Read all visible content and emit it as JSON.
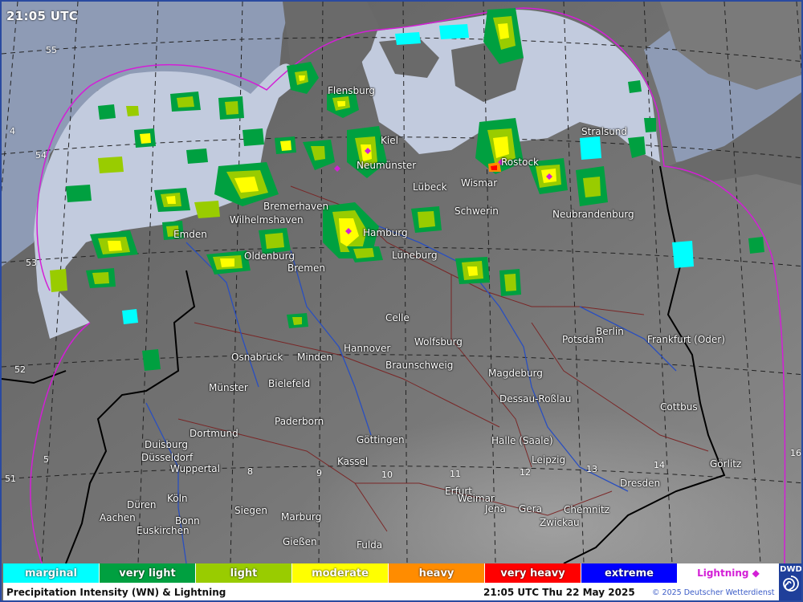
{
  "time_label": "21:05 UTC",
  "cities": [
    {
      "name": "Flensburg",
      "key": "flensburg"
    },
    {
      "name": "Kiel",
      "key": "kiel"
    },
    {
      "name": "Neumünster",
      "key": "neumuenster"
    },
    {
      "name": "Stralsund",
      "key": "stralsund"
    },
    {
      "name": "Rostock",
      "key": "rostock"
    },
    {
      "name": "Lübeck",
      "key": "luebeck"
    },
    {
      "name": "Wismar",
      "key": "wismar"
    },
    {
      "name": "Bremerhaven",
      "key": "bremerhaven"
    },
    {
      "name": "Wilhelmshaven",
      "key": "wilhelmshaven"
    },
    {
      "name": "Schwerin",
      "key": "schwerin"
    },
    {
      "name": "Neubrandenburg",
      "key": "neubrandenburg"
    },
    {
      "name": "Emden",
      "key": "emden"
    },
    {
      "name": "Hamburg",
      "key": "hamburg"
    },
    {
      "name": "Oldenburg",
      "key": "oldenburg"
    },
    {
      "name": "Bremen",
      "key": "bremen"
    },
    {
      "name": "Lüneburg",
      "key": "lueneburg"
    },
    {
      "name": "Celle",
      "key": "celle"
    },
    {
      "name": "Berlin",
      "key": "berlin"
    },
    {
      "name": "Wolfsburg",
      "key": "wolfsburg"
    },
    {
      "name": "Osnabrück",
      "key": "osnabrueck"
    },
    {
      "name": "Minden",
      "key": "minden"
    },
    {
      "name": "Hannover",
      "key": "hannover"
    },
    {
      "name": "Potsdam",
      "key": "potsdam"
    },
    {
      "name": "Frankfurt (Oder)",
      "key": "frankfurt_oder"
    },
    {
      "name": "Braunschweig",
      "key": "braunschweig"
    },
    {
      "name": "Magdeburg",
      "key": "magdeburg"
    },
    {
      "name": "Münster",
      "key": "muenster"
    },
    {
      "name": "Bielefeld",
      "key": "bielefeld"
    },
    {
      "name": "Dessau-Roßlau",
      "key": "dessau"
    },
    {
      "name": "Cottbus",
      "key": "cottbus"
    },
    {
      "name": "Paderborn",
      "key": "paderborn"
    },
    {
      "name": "Dortmund",
      "key": "dortmund"
    },
    {
      "name": "Duisburg",
      "key": "duisburg"
    },
    {
      "name": "Düsseldorf",
      "key": "duesseldorf"
    },
    {
      "name": "Wuppertal",
      "key": "wuppertal"
    },
    {
      "name": "Göttingen",
      "key": "goettingen"
    },
    {
      "name": "Halle (Saale)",
      "key": "halle"
    },
    {
      "name": "Kassel",
      "key": "kassel"
    },
    {
      "name": "Leipzig",
      "key": "leipzig"
    },
    {
      "name": "Görlitz",
      "key": "goerlitz"
    },
    {
      "name": "Dresden",
      "key": "dresden"
    },
    {
      "name": "Erfurt",
      "key": "erfurt"
    },
    {
      "name": "Weimar",
      "key": "weimar"
    },
    {
      "name": "Köln",
      "key": "koeln"
    },
    {
      "name": "Düren",
      "key": "dueren"
    },
    {
      "name": "Aachen",
      "key": "aachen"
    },
    {
      "name": "Siegen",
      "key": "siegen"
    },
    {
      "name": "Marburg",
      "key": "marburg"
    },
    {
      "name": "Jena",
      "key": "jena"
    },
    {
      "name": "Gera",
      "key": "gera"
    },
    {
      "name": "Chemnitz",
      "key": "chemnitz"
    },
    {
      "name": "Bonn",
      "key": "bonn"
    },
    {
      "name": "Zwickau",
      "key": "zwickau"
    },
    {
      "name": "Euskirchen",
      "key": "euskirchen"
    },
    {
      "name": "Gießen",
      "key": "giessen"
    },
    {
      "name": "Fulda",
      "key": "fulda"
    }
  ],
  "grid_labels": {
    "lat": [
      "55",
      "54",
      "53",
      "52",
      "51"
    ],
    "lon": [
      "4",
      "5",
      "8",
      "9",
      "10",
      "11",
      "12",
      "13",
      "14",
      "16"
    ]
  },
  "legend": [
    {
      "label": "marginal",
      "color": "#00ffff"
    },
    {
      "label": "very light",
      "color": "#00a040"
    },
    {
      "label": "light",
      "color": "#99cc00"
    },
    {
      "label": "moderate",
      "color": "#ffff00"
    },
    {
      "label": "heavy",
      "color": "#ff8c00"
    },
    {
      "label": "very heavy",
      "color": "#ff0000"
    },
    {
      "label": "extreme",
      "color": "#0000ff"
    }
  ],
  "lightning_label": "Lightning ◆",
  "lightning_color": "#d31fd6",
  "footer": {
    "title": "Precipitation Intensity (WN) & Lightning",
    "datetime": "21:05 UTC Thu 22 May 2025",
    "copyright": "© 2025 Deutscher Wetterdienst"
  },
  "logo_text": "DWD",
  "colors": {
    "sea": "#c2cbde",
    "land": "#6e6e6e",
    "coverage_boundary": "#d31fd6",
    "frame": "#2a4aa0"
  }
}
